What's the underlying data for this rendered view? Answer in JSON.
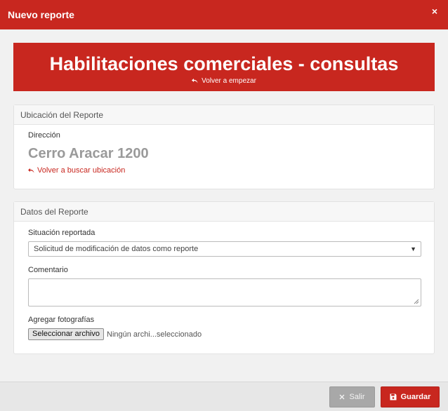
{
  "header": {
    "title": "Nuevo reporte",
    "close_glyph": "×"
  },
  "banner": {
    "title": "Habilitaciones comerciales - consultas",
    "restart_label": "Volver a empezar"
  },
  "location_panel": {
    "heading": "Ubicación del Reporte",
    "address_label": "Dirección",
    "address_value": "Cerro Aracar 1200",
    "search_again_label": "Volver a buscar ubicación"
  },
  "report_panel": {
    "heading": "Datos del Reporte",
    "situation_label": "Situación reportada",
    "situation_value": "Solicitud de modificación de datos como reporte",
    "comment_label": "Comentario",
    "photos_label": "Agregar fotografías",
    "file_button_label": "Seleccionar archivo",
    "file_status": "Ningún archi...seleccionado"
  },
  "footer": {
    "exit_label": "Salir",
    "save_label": "Guardar"
  },
  "colors": {
    "brand": "#c8271f",
    "muted": "#a8a8a8"
  },
  "icons": {
    "undo": "undo-arrow-icon",
    "close": "close-icon",
    "save": "floppy-disk-icon",
    "exit": "x-icon"
  }
}
